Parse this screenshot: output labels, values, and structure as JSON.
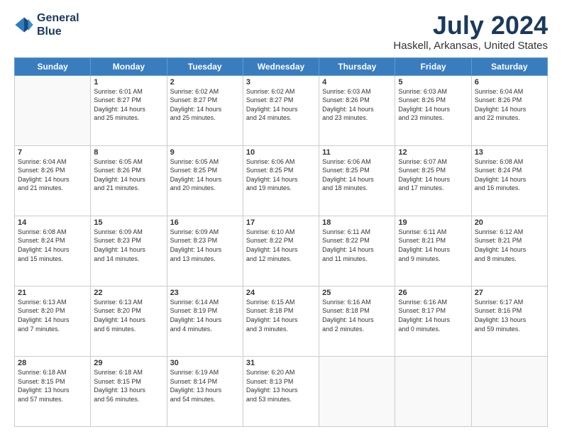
{
  "logo": {
    "line1": "General",
    "line2": "Blue"
  },
  "title": "July 2024",
  "subtitle": "Haskell, Arkansas, United States",
  "days_of_week": [
    "Sunday",
    "Monday",
    "Tuesday",
    "Wednesday",
    "Thursday",
    "Friday",
    "Saturday"
  ],
  "weeks": [
    [
      {
        "num": "",
        "info": ""
      },
      {
        "num": "1",
        "info": "Sunrise: 6:01 AM\nSunset: 8:27 PM\nDaylight: 14 hours\nand 25 minutes."
      },
      {
        "num": "2",
        "info": "Sunrise: 6:02 AM\nSunset: 8:27 PM\nDaylight: 14 hours\nand 25 minutes."
      },
      {
        "num": "3",
        "info": "Sunrise: 6:02 AM\nSunset: 8:27 PM\nDaylight: 14 hours\nand 24 minutes."
      },
      {
        "num": "4",
        "info": "Sunrise: 6:03 AM\nSunset: 8:26 PM\nDaylight: 14 hours\nand 23 minutes."
      },
      {
        "num": "5",
        "info": "Sunrise: 6:03 AM\nSunset: 8:26 PM\nDaylight: 14 hours\nand 23 minutes."
      },
      {
        "num": "6",
        "info": "Sunrise: 6:04 AM\nSunset: 8:26 PM\nDaylight: 14 hours\nand 22 minutes."
      }
    ],
    [
      {
        "num": "7",
        "info": "Sunrise: 6:04 AM\nSunset: 8:26 PM\nDaylight: 14 hours\nand 21 minutes."
      },
      {
        "num": "8",
        "info": "Sunrise: 6:05 AM\nSunset: 8:26 PM\nDaylight: 14 hours\nand 21 minutes."
      },
      {
        "num": "9",
        "info": "Sunrise: 6:05 AM\nSunset: 8:25 PM\nDaylight: 14 hours\nand 20 minutes."
      },
      {
        "num": "10",
        "info": "Sunrise: 6:06 AM\nSunset: 8:25 PM\nDaylight: 14 hours\nand 19 minutes."
      },
      {
        "num": "11",
        "info": "Sunrise: 6:06 AM\nSunset: 8:25 PM\nDaylight: 14 hours\nand 18 minutes."
      },
      {
        "num": "12",
        "info": "Sunrise: 6:07 AM\nSunset: 8:25 PM\nDaylight: 14 hours\nand 17 minutes."
      },
      {
        "num": "13",
        "info": "Sunrise: 6:08 AM\nSunset: 8:24 PM\nDaylight: 14 hours\nand 16 minutes."
      }
    ],
    [
      {
        "num": "14",
        "info": "Sunrise: 6:08 AM\nSunset: 8:24 PM\nDaylight: 14 hours\nand 15 minutes."
      },
      {
        "num": "15",
        "info": "Sunrise: 6:09 AM\nSunset: 8:23 PM\nDaylight: 14 hours\nand 14 minutes."
      },
      {
        "num": "16",
        "info": "Sunrise: 6:09 AM\nSunset: 8:23 PM\nDaylight: 14 hours\nand 13 minutes."
      },
      {
        "num": "17",
        "info": "Sunrise: 6:10 AM\nSunset: 8:22 PM\nDaylight: 14 hours\nand 12 minutes."
      },
      {
        "num": "18",
        "info": "Sunrise: 6:11 AM\nSunset: 8:22 PM\nDaylight: 14 hours\nand 11 minutes."
      },
      {
        "num": "19",
        "info": "Sunrise: 6:11 AM\nSunset: 8:21 PM\nDaylight: 14 hours\nand 9 minutes."
      },
      {
        "num": "20",
        "info": "Sunrise: 6:12 AM\nSunset: 8:21 PM\nDaylight: 14 hours\nand 8 minutes."
      }
    ],
    [
      {
        "num": "21",
        "info": "Sunrise: 6:13 AM\nSunset: 8:20 PM\nDaylight: 14 hours\nand 7 minutes."
      },
      {
        "num": "22",
        "info": "Sunrise: 6:13 AM\nSunset: 8:20 PM\nDaylight: 14 hours\nand 6 minutes."
      },
      {
        "num": "23",
        "info": "Sunrise: 6:14 AM\nSunset: 8:19 PM\nDaylight: 14 hours\nand 4 minutes."
      },
      {
        "num": "24",
        "info": "Sunrise: 6:15 AM\nSunset: 8:18 PM\nDaylight: 14 hours\nand 3 minutes."
      },
      {
        "num": "25",
        "info": "Sunrise: 6:16 AM\nSunset: 8:18 PM\nDaylight: 14 hours\nand 2 minutes."
      },
      {
        "num": "26",
        "info": "Sunrise: 6:16 AM\nSunset: 8:17 PM\nDaylight: 14 hours\nand 0 minutes."
      },
      {
        "num": "27",
        "info": "Sunrise: 6:17 AM\nSunset: 8:16 PM\nDaylight: 13 hours\nand 59 minutes."
      }
    ],
    [
      {
        "num": "28",
        "info": "Sunrise: 6:18 AM\nSunset: 8:15 PM\nDaylight: 13 hours\nand 57 minutes."
      },
      {
        "num": "29",
        "info": "Sunrise: 6:18 AM\nSunset: 8:15 PM\nDaylight: 13 hours\nand 56 minutes."
      },
      {
        "num": "30",
        "info": "Sunrise: 6:19 AM\nSunset: 8:14 PM\nDaylight: 13 hours\nand 54 minutes."
      },
      {
        "num": "31",
        "info": "Sunrise: 6:20 AM\nSunset: 8:13 PM\nDaylight: 13 hours\nand 53 minutes."
      },
      {
        "num": "",
        "info": ""
      },
      {
        "num": "",
        "info": ""
      },
      {
        "num": "",
        "info": ""
      }
    ]
  ]
}
